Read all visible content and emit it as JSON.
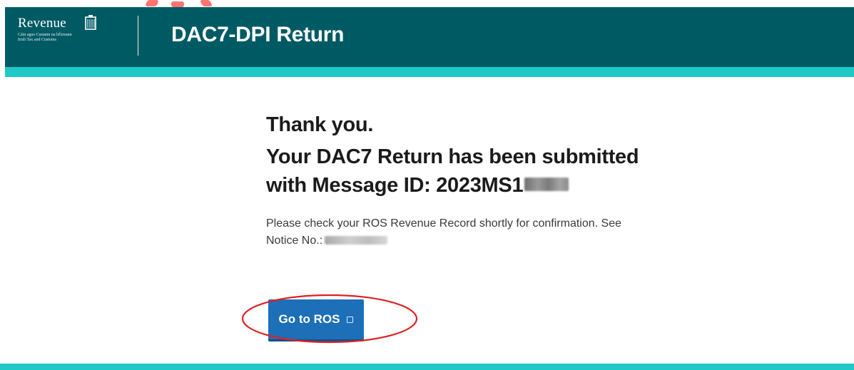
{
  "header": {
    "logo": {
      "wordmark": "Revenue",
      "subtitle_line1": "Cáin agus Custaim na hÉireann",
      "subtitle_line2": "Irish Tax and Customs"
    },
    "service_title": "DAC7-DPI Return"
  },
  "main": {
    "thanks": "Thank you.",
    "confirmation_line1": "Your DAC7 Return has been submitted",
    "confirmation_line2_prefix": "with Message ID: 2023MS1",
    "info_text": "Please check your ROS Revenue Record shortly for confirmation. See",
    "notice_label": "Notice No.:",
    "go_button_label": "Go to ROS"
  },
  "colors": {
    "header_bg": "#005a64",
    "accent_stripe": "#1fc9c7",
    "button_bg": "#1d6fb8",
    "annotation": "#e02020"
  },
  "icons": {
    "logo": "harp-icon",
    "button": "external-link-icon"
  }
}
